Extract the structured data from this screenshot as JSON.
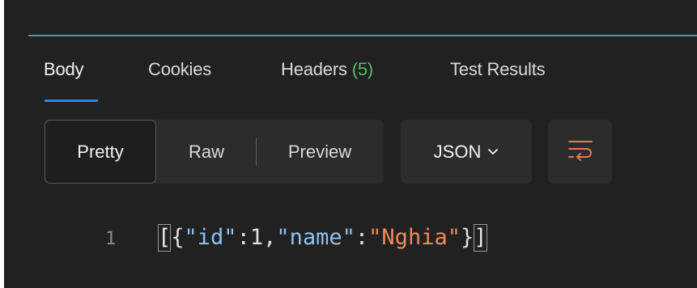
{
  "tabs": [
    {
      "label": "Body",
      "active": true
    },
    {
      "label": "Cookies",
      "active": false
    },
    {
      "label": "Headers",
      "badge": "(5)",
      "active": false
    },
    {
      "label": "Test Results",
      "active": false
    }
  ],
  "view_modes": [
    {
      "label": "Pretty",
      "active": true
    },
    {
      "label": "Raw",
      "active": false
    },
    {
      "label": "Preview",
      "active": false
    }
  ],
  "format_select": {
    "value": "JSON",
    "icon": "chevron-down-icon"
  },
  "wrap_button": {
    "icon": "wrap-lines-icon"
  },
  "response": {
    "line_number": "1",
    "open_bracket": "[",
    "open_brace": "{",
    "key1": "\"id\"",
    "colon": ":",
    "value1": "1",
    "comma": ",",
    "key2": "\"name\"",
    "value2": "\"Nghia\"",
    "close_brace": "}",
    "close_bracket": "]"
  },
  "colors": {
    "panel_bg": "#212121",
    "accent_blue": "#2f86d6",
    "badge_green": "#4fbf5f",
    "string_orange": "#f08a5a",
    "key_blue": "#8fc2f0",
    "wrap_icon_orange": "#e8774a"
  }
}
